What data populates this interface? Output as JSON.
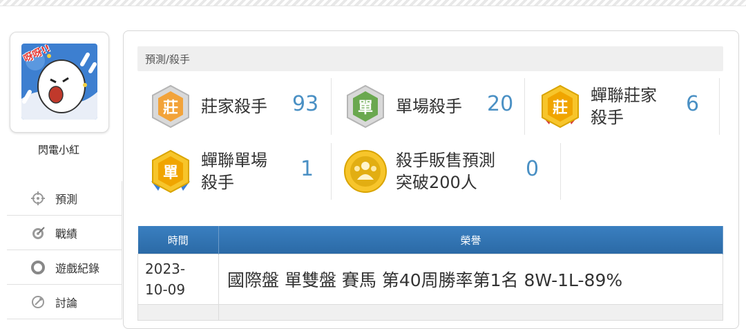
{
  "user": {
    "name": "閃電小紅",
    "avatar_text": "呀呀!!"
  },
  "sidebar": {
    "items": [
      {
        "label": "預測",
        "icon": "crosshair-icon"
      },
      {
        "label": "戰績",
        "icon": "target-icon"
      },
      {
        "label": "遊戲紀錄",
        "icon": "circle-icon"
      },
      {
        "label": "討論",
        "icon": "chat-icon"
      }
    ]
  },
  "breadcrumb": "預測/殺手",
  "stats": [
    {
      "label": "莊家殺手",
      "value": "93",
      "medal": "莊",
      "medal_color": "#e98d2f"
    },
    {
      "label": "單場殺手",
      "value": "20",
      "medal": "單",
      "medal_color": "#6aa84f"
    },
    {
      "label": "蟬聯莊家\n殺手",
      "value": "6",
      "medal": "莊",
      "medal_color": "#f0a500"
    },
    {
      "label": "蟬聯單場\n殺手",
      "value": "1",
      "medal": "單",
      "medal_color": "#f0a500"
    },
    {
      "label": "殺手販售預測\n突破200人",
      "value": "0",
      "medal": "people",
      "medal_color": "#d9a400"
    }
  ],
  "table": {
    "headers": [
      "時間",
      "榮譽"
    ],
    "rows": [
      {
        "time": "2023-\n10-09",
        "honor": "國際盤 單雙盤 賽馬 第40周勝率第1名 8W-1L-89%"
      }
    ]
  },
  "colors": {
    "accent": "#4a90c4",
    "header_blue": "#2b6aa6"
  }
}
